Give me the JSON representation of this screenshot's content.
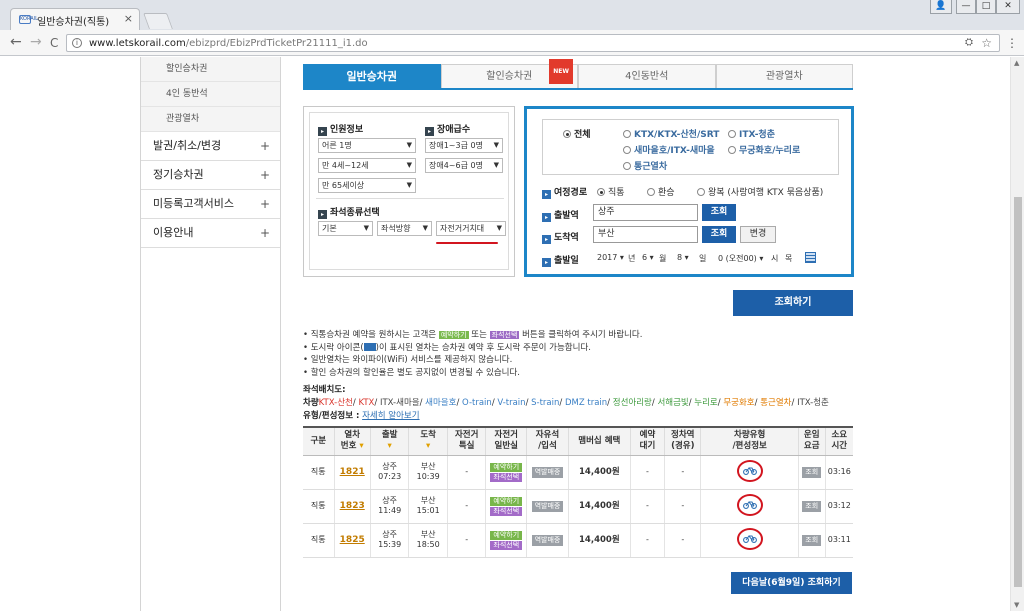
{
  "browser": {
    "tab_title": "일반승차권(직통)",
    "tab_close": "×",
    "favicon_text": "KORAIL",
    "url_host": "www.letskorail.com",
    "url_path": "/ebizprd/EbizPrdTicketPr21111_i1.do",
    "nav_back": "←",
    "nav_forward": "→",
    "nav_reload": "C",
    "window_user": "👤",
    "window_min": "—",
    "window_max": "□",
    "window_close": "✕"
  },
  "sidebar": {
    "sub_items": [
      "할인승차권",
      "4인 동반석",
      "관광열차"
    ],
    "main_items": [
      {
        "label": "발권/취소/변경",
        "icon": "+"
      },
      {
        "label": "정기승차권",
        "icon": "+"
      },
      {
        "label": "미등록고객서비스",
        "icon": "+"
      },
      {
        "label": "이용안내",
        "icon": "+"
      }
    ]
  },
  "top_tabs": [
    {
      "label": "일반승차권",
      "active": true
    },
    {
      "label": "할인승차권",
      "badge": "NEW"
    },
    {
      "label": "4인동반석"
    },
    {
      "label": "관광열차"
    }
  ],
  "passengers": {
    "title": "인원정보",
    "adult": "어른 1명",
    "child": "만 4세~12세",
    "senior": "만 65세이상"
  },
  "disabled": {
    "title": "장애급수",
    "grade13": "장애1~3급 0명",
    "grade46": "장애4~6급 0명"
  },
  "seat_type": {
    "title": "좌석종류선택",
    "basic": "기본",
    "direction": "좌석방향",
    "bike": "자전거거치대"
  },
  "train_types": {
    "all": "전체",
    "ktx": "KTX/KTX-산천/SRT",
    "itx_cheongchun": "ITX-청춘",
    "saemaeul": "새마을호/ITX-새마을",
    "mugunghwa": "무궁화호/누리로",
    "commute": "통근열차"
  },
  "route": {
    "label": "여정경로",
    "direct": "직통",
    "transfer": "환승",
    "round_trip": "왕복 (사랑여행 KTX 묶음상품)"
  },
  "departure": {
    "label": "출발역",
    "value": "상주",
    "button": "조회"
  },
  "arrival": {
    "label": "도착역",
    "value": "부산",
    "button": "조회",
    "swap": "변경"
  },
  "date": {
    "label": "출발일",
    "year": "2017",
    "year_unit": "년",
    "month": "6",
    "month_unit": "월",
    "day": "8",
    "day_unit": "일",
    "hour": "0 (오전00)",
    "hour_unit": "시",
    "weekday": "목"
  },
  "lookup_button": "조회하기",
  "notices": {
    "n1_pre": "• 직통승차권 예약을 원하시는 고객은",
    "n1_green": "예약하기",
    "n1_mid": "또는",
    "n1_purple": "좌석선택",
    "n1_post": "버튼을 클릭하여 주시기 바랍니다.",
    "n2_pre": "• 도시락 아이콘(",
    "n2_post": ")이 표시된 열차는 승차권 예약 후 도시락 주문이 가능합니다.",
    "n3": "• 일반열차는 와이파이(WiFi) 서비스를 제공하지 않습니다.",
    "n4": "• 할인 승차권의 할인율은 별도 공지없이 변경될 수 있습니다."
  },
  "legend": {
    "title": "좌석배치도:",
    "prefix": "차량",
    "items": [
      "KTX-산천",
      "KTX",
      "ITX-새마을",
      "새마을호",
      "O-train",
      "V-train",
      "S-train",
      "DMZ train",
      "정선아리랑",
      "서해금빛",
      "누리로",
      "무궁화호",
      "통근열차",
      "ITX-청춘"
    ],
    "formation_label": "유형/편성정보 :",
    "formation_link": "자세히 알아보기"
  },
  "table": {
    "headers": [
      "구분",
      "열차\n번호",
      "출발",
      "도착",
      "자전거\n특실",
      "자전거\n일반실",
      "자유석\n/입석",
      "맴버십 혜택",
      "예약\n대기",
      "정차역\n(경유)",
      "차량유형\n/편성정보",
      "운임\n요금",
      "소요\n시간"
    ],
    "reserve": "예약하기",
    "seat_select": "좌석선택",
    "station_sale": "역발매중",
    "fare_btn": "조회",
    "rows": [
      {
        "kind": "직통",
        "no": "1821",
        "dep_st": "상주",
        "dep_time": "07:23",
        "arr_st": "부산",
        "arr_time": "10:39",
        "bike_first": "-",
        "price": "14,400원",
        "wait": "-",
        "stops": "-",
        "duration": "03:16"
      },
      {
        "kind": "직통",
        "no": "1823",
        "dep_st": "상주",
        "dep_time": "11:49",
        "arr_st": "부산",
        "arr_time": "15:01",
        "bike_first": "-",
        "price": "14,400원",
        "wait": "-",
        "stops": "-",
        "duration": "03:12"
      },
      {
        "kind": "직통",
        "no": "1825",
        "dep_st": "상주",
        "dep_time": "15:39",
        "arr_st": "부산",
        "arr_time": "18:50",
        "bike_first": "-",
        "price": "14,400원",
        "wait": "-",
        "stops": "-",
        "duration": "03:11"
      }
    ]
  },
  "next_day_button": "다음날(6월9일) 조회하기",
  "colors": {
    "accent": "#1d86c8",
    "button": "#1d5fa8",
    "highlight": "#d2151f"
  }
}
